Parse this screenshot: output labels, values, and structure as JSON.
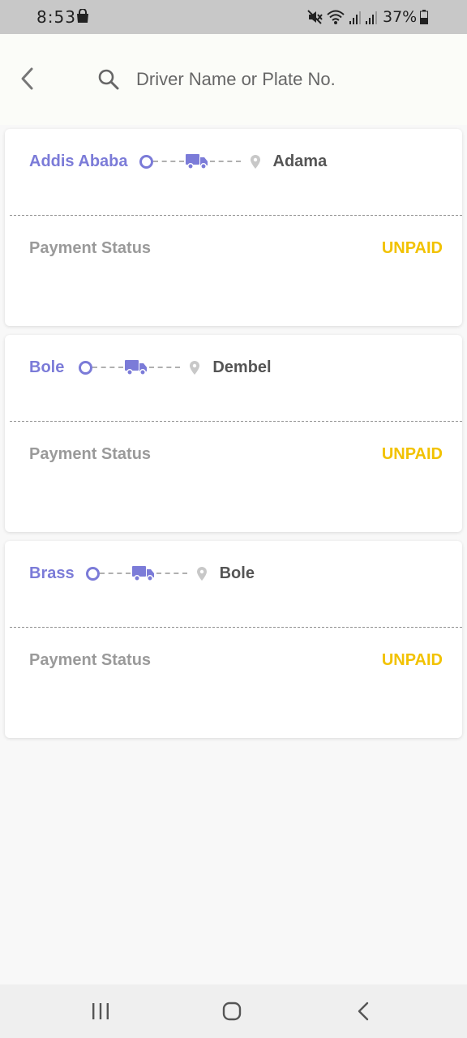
{
  "status_bar": {
    "time": "8:53",
    "battery": "37%",
    "icons": [
      "shopping-bag-icon",
      "mute-icon",
      "wifi-icon",
      "signal-icon",
      "signal-icon",
      "battery-icon"
    ]
  },
  "search": {
    "placeholder": "Driver Name or Plate No.",
    "value": ""
  },
  "colors": {
    "accent": "#7b7bd8",
    "unpaid": "#f2c200",
    "label": "#9a9a9a"
  },
  "trips": [
    {
      "origin": "Addis Ababa",
      "destination": "Adama",
      "payment_label": "Payment Status",
      "payment_status": "UNPAID"
    },
    {
      "origin": "Bole",
      "destination": "Dembel",
      "payment_label": "Payment Status",
      "payment_status": "UNPAID"
    },
    {
      "origin": "Brass",
      "destination": "Bole",
      "payment_label": "Payment Status",
      "payment_status": "UNPAID"
    }
  ],
  "nav": [
    "recent-apps-icon",
    "home-icon",
    "back-icon"
  ]
}
